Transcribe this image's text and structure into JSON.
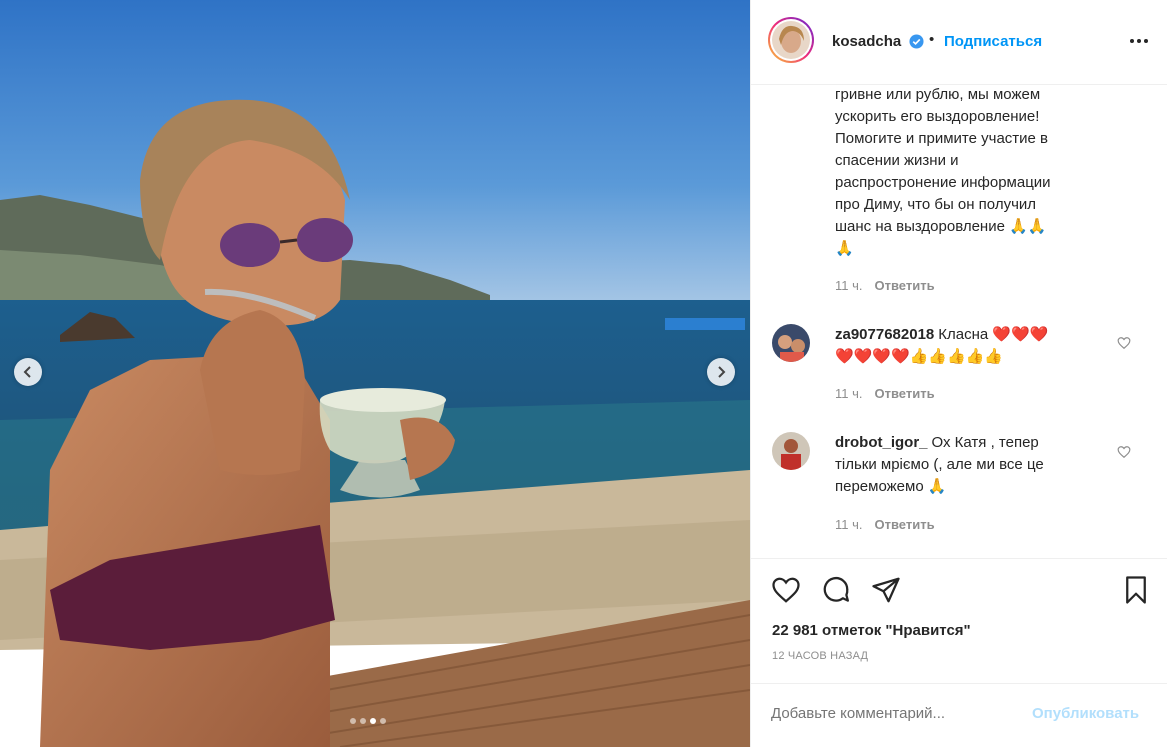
{
  "post": {
    "username": "kosadcha",
    "separator": "•",
    "follow_label": "Подписаться"
  },
  "caption": {
    "lines": [
      "гривне или рублю, мы можем",
      "ускорить его выздоровление!",
      "Помогите и примите участие в",
      "спасении жизни и",
      "распростронение информации",
      "про Диму, что бы он получил",
      "шанс на выздоровление 🙏🙏",
      "🙏"
    ],
    "time": "11 ч.",
    "reply_label": "Ответить"
  },
  "comments": [
    {
      "username": "za9077682018",
      "text": "Класна ❤️❤️❤️",
      "text2": "❤️❤️❤️❤️👍👍👍👍👍",
      "time": "11 ч.",
      "reply_label": "Ответить"
    },
    {
      "username": "drobot_igor_",
      "text": "Ох Катя , тепер",
      "text2": "тільки мрiємо (, але ми все це",
      "text3": "переможемо 🙏",
      "time": "11 ч.",
      "reply_label": "Ответить"
    }
  ],
  "stats": {
    "likes": "22 981 отметок \"Нравится\"",
    "time_ago": "12 часов назад"
  },
  "composer": {
    "placeholder": "Добавьте комментарий...",
    "publish_label": "Опубликовать"
  },
  "carousel": {
    "count": 4,
    "active_index": 2
  },
  "colors": {
    "accent": "#0095f6",
    "publish_disabled": "#b2dffc",
    "text": "#262626",
    "muted": "#8e8e8e"
  }
}
